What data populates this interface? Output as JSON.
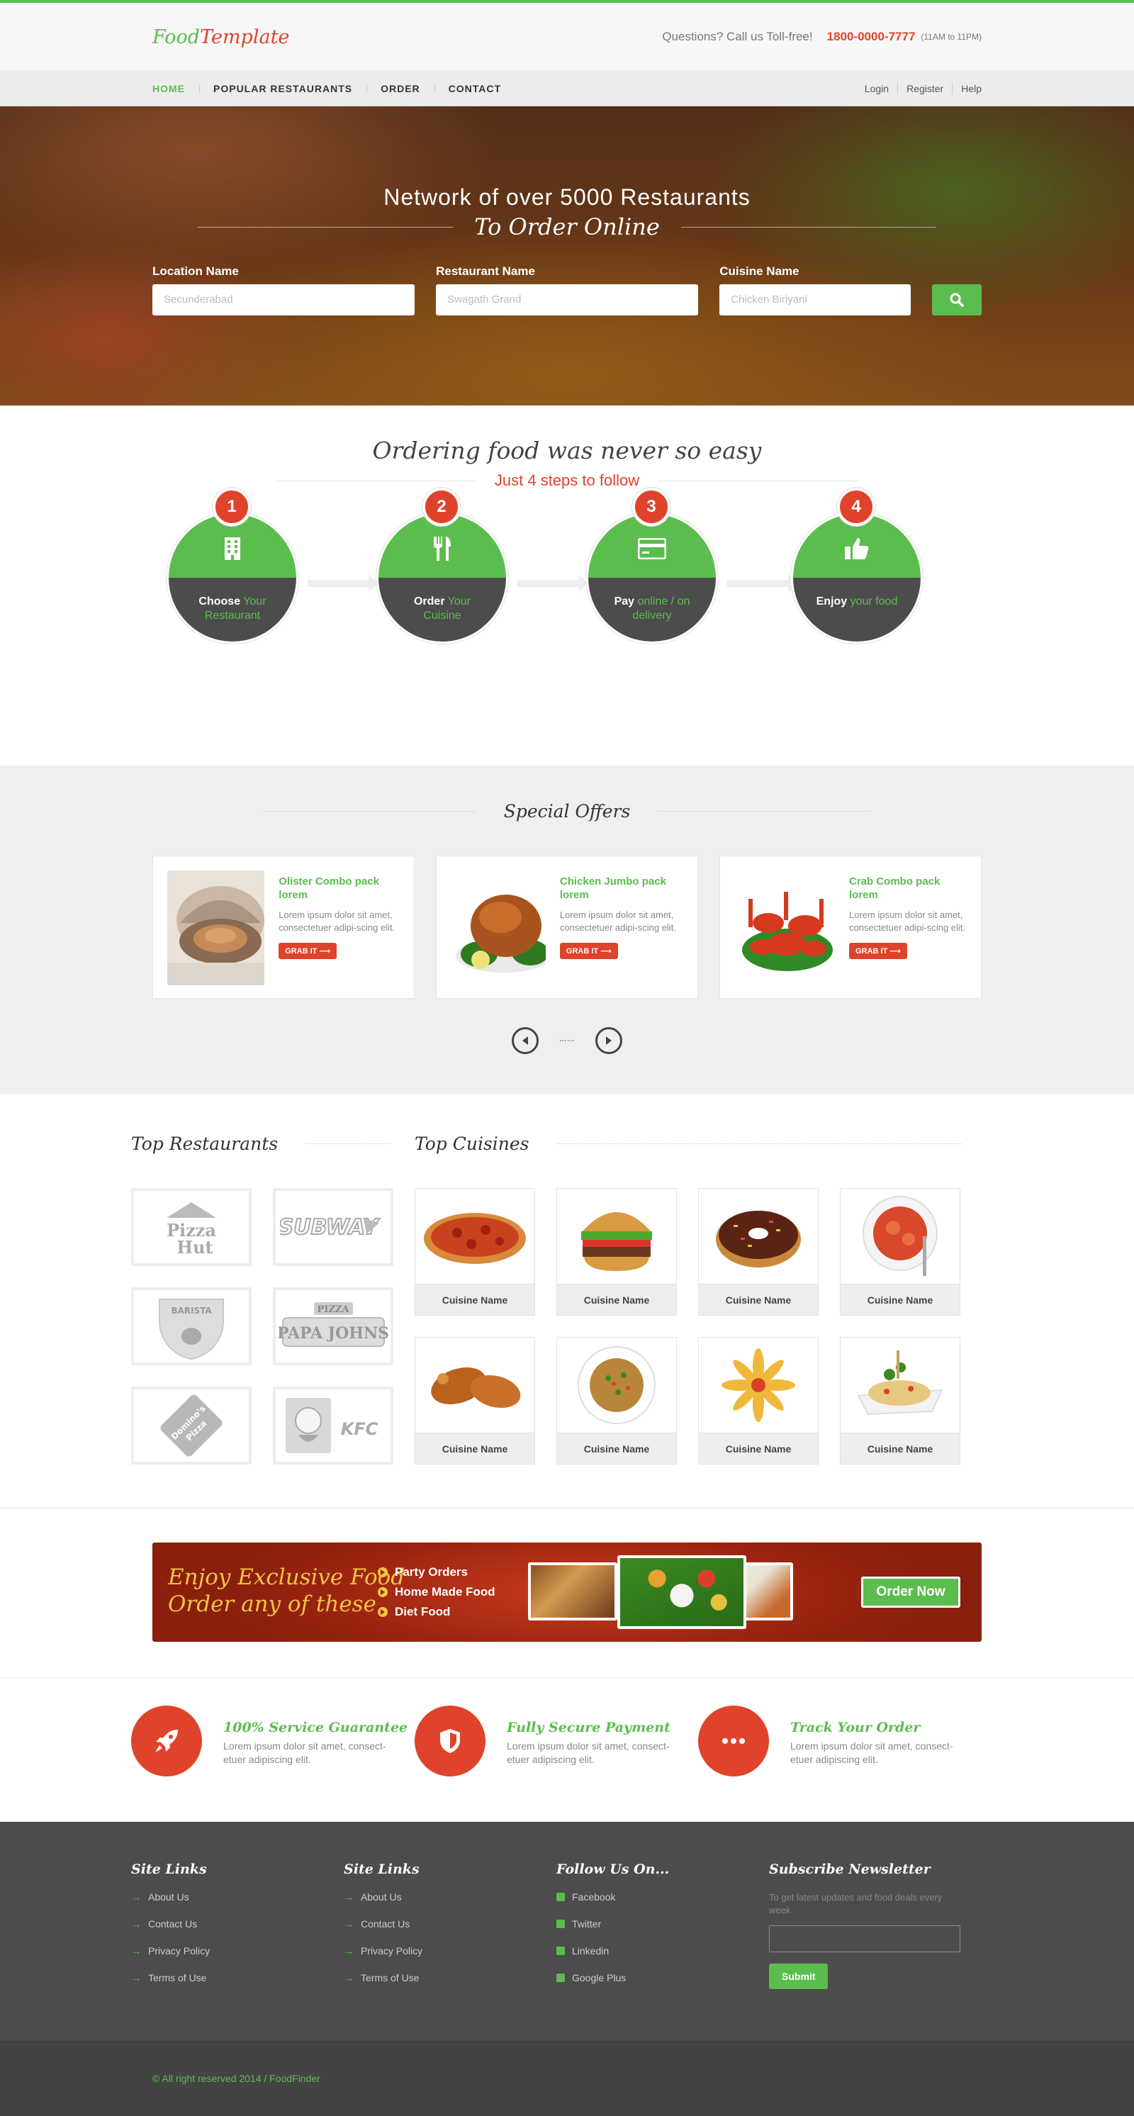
{
  "header": {
    "logo_part1": "Food",
    "logo_part2": "Template",
    "questions": "Questions? Call us Toll-free!",
    "phone": "1800-0000-7777",
    "hours": "(11AM to 11PM)"
  },
  "nav": {
    "items": [
      "HOME",
      "POPULAR RESTAURANTS",
      "ORDER",
      "CONTACT"
    ],
    "right": [
      "Login",
      "Register",
      "Help"
    ]
  },
  "hero": {
    "title": "Network of over 5000 Restaurants",
    "subtitle": "To Order Online",
    "fields": [
      {
        "label": "Location Name",
        "placeholder": "Secunderabad"
      },
      {
        "label": "Restaurant Name",
        "placeholder": "Swagath Grand"
      },
      {
        "label": "Cuisine Name",
        "placeholder": "Chicken Biriyani"
      }
    ]
  },
  "steps": {
    "title": "Ordering food was never so easy",
    "subtitle": "Just 4 steps to follow",
    "items": [
      {
        "num": "1",
        "bold": "Choose",
        "rest": "Your Restaurant"
      },
      {
        "num": "2",
        "bold": "Order",
        "rest": "Your Cuisine"
      },
      {
        "num": "3",
        "bold": "Pay",
        "rest": "online / on delivery"
      },
      {
        "num": "4",
        "bold": "Enjoy",
        "rest": "your food"
      }
    ]
  },
  "offers": {
    "title": "Special Offers",
    "cards": [
      {
        "name": "Olister Combo pack lorem",
        "desc": "Lorem ipsum dolor sit amet, consectetuer adipi-scing elit.",
        "button": "GRAB IT ⟶"
      },
      {
        "name": "Chicken Jumbo pack lorem",
        "desc": "Lorem ipsum dolor sit amet, consectetuer adipi-scing elit.",
        "button": "GRAB IT ⟶"
      },
      {
        "name": "Crab Combo pack lorem",
        "desc": "Lorem ipsum dolor sit amet, consectetuer adipi-scing elit.",
        "button": "GRAB IT ⟶"
      }
    ]
  },
  "top_restaurants": {
    "title": "Top Restaurants",
    "logos": [
      {
        "name": "Pizza Hut",
        "line1": "Pizza",
        "line2": "Hut"
      },
      {
        "name": "Subway",
        "line1": "SUBWAY",
        "line2": ""
      },
      {
        "name": "Barista",
        "line1": "BARISTA",
        "line2": ""
      },
      {
        "name": "Papa John's",
        "line1": "PIZZA",
        "line2": "PAPA JOHNS"
      },
      {
        "name": "Domino's Pizza",
        "line1": "Domino's",
        "line2": "Pizza"
      },
      {
        "name": "KFC",
        "line1": "KFC",
        "line2": ""
      }
    ]
  },
  "top_cuisines": {
    "title": "Top Cuisines",
    "items": [
      "Cuisine Name",
      "Cuisine Name",
      "Cuisine Name",
      "Cuisine Name",
      "Cuisine Name",
      "Cuisine Name",
      "Cuisine Name",
      "Cuisine Name"
    ]
  },
  "banner": {
    "line1": "Enjoy Exclusive Food",
    "line2": "Order any of these",
    "items": [
      "Party Orders",
      "Home Made Food",
      "Diet Food"
    ],
    "button": "Order Now"
  },
  "features": [
    {
      "title": "100% Service Guarantee",
      "desc": "Lorem ipsum dolor sit amet, consect-etuer adipiscing elit."
    },
    {
      "title": "Fully Secure Payment",
      "desc": "Lorem ipsum dolor sit amet, consect-etuer adipiscing elit."
    },
    {
      "title": "Track Your Order",
      "desc": "Lorem ipsum dolor sit amet, consect-etuer adipiscing elit."
    }
  ],
  "footer": {
    "col1": {
      "title": "Site Links",
      "links": [
        "About Us",
        "Contact Us",
        "Privacy Policy",
        "Terms of Use"
      ]
    },
    "col2": {
      "title": "Site Links",
      "links": [
        "About Us",
        "Contact Us",
        "Privacy Policy",
        "Terms of Use"
      ]
    },
    "col3": {
      "title": "Follow Us On...",
      "links": [
        "Facebook",
        "Twitter",
        "Linkedin",
        "Google Plus"
      ]
    },
    "newsletter": {
      "title": "Subscribe Newsletter",
      "desc": "To get latest updates and food deals every week",
      "button": "Submit"
    },
    "copyright": "© All right reserved 2014  /  FoodFinder"
  },
  "colors": {
    "green": "#5bbd4e",
    "red": "#e0432b",
    "dark": "#4c4c4c"
  }
}
